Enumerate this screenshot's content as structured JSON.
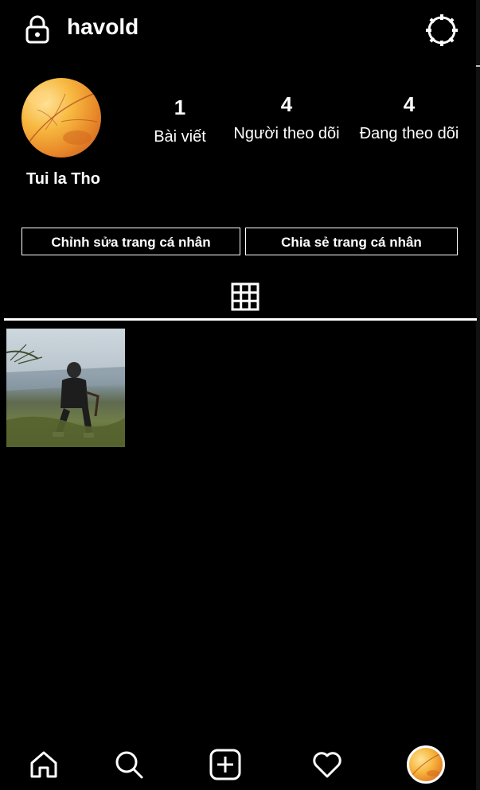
{
  "header": {
    "username": "havold",
    "lock_icon": "lock-icon",
    "settings_icon": "gear-icon"
  },
  "profile": {
    "display_name": "Tui la Tho",
    "avatar": "avatar",
    "stats": {
      "posts": {
        "count": "1",
        "label": "Bài viết"
      },
      "followers": {
        "count": "4",
        "label": "Người theo dõi"
      },
      "following": {
        "count": "4",
        "label": "Đang theo dõi"
      }
    },
    "buttons": {
      "edit": "Chỉnh sửa trang cá nhân",
      "share": "Chia sẻ trang cá nhân"
    }
  },
  "tabs": {
    "grid_icon": "grid-icon"
  },
  "posts": [
    {
      "type": "photo"
    }
  ],
  "bottom_nav": {
    "items": [
      "home-icon",
      "search-icon",
      "add-post-icon",
      "heart-icon",
      "profile-avatar"
    ]
  },
  "colors": {
    "background": "#000000",
    "foreground": "#ffffff"
  }
}
